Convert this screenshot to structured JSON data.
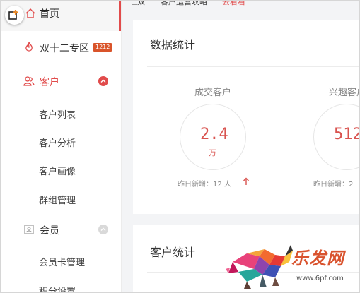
{
  "sidebar": {
    "home": {
      "label": "首页"
    },
    "items": [
      {
        "label": "双十二专区",
        "badge": "1212"
      },
      {
        "label": "客户"
      },
      {
        "label": "会员"
      }
    ],
    "customer_sub": [
      "客户列表",
      "客户分析",
      "客户画像",
      "群组管理"
    ],
    "member_sub": [
      "会员卡管理",
      "积分设置"
    ]
  },
  "topbar": {
    "text": "双十二客户运营攻略",
    "link": "去看看"
  },
  "stats_card": {
    "title": "数据统计",
    "stats": [
      {
        "label": "成交客户",
        "value": "2.4",
        "unit": "万",
        "foot": "昨日新增：12 人"
      },
      {
        "label": "兴趣客户",
        "value": "512",
        "unit": "",
        "foot": "昨日新增：2"
      }
    ]
  },
  "customer_card": {
    "title": "客户统计"
  },
  "watermark": {
    "logo_text": "乐发网",
    "url": "www.6pf.com"
  },
  "colors": {
    "accent": "#e14b4b",
    "badge": "#d9542a",
    "value": "#d9534f"
  }
}
